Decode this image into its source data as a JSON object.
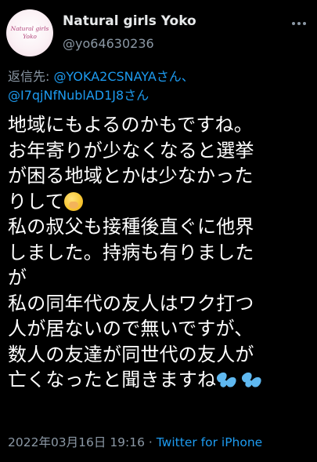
{
  "user": {
    "avatar_text": "Natural girls\nYoko",
    "display_name": "Natural girls Yoko",
    "handle": "@yo64630236"
  },
  "more_icon": "more-horizontal-icon",
  "reply": {
    "prefix": "返信先: ",
    "mention1": "@YOKA2CSNAYAさん、",
    "mention2": "@I7qjNfNublAD1J8さん"
  },
  "body_lines": [
    "地域にもよるのかもですね。",
    "お年寄りが少なくなると選挙",
    "が困る地域とかは少なかった",
    "りして",
    "私の叔父も接種後直ぐに他界",
    "しました。持病も有りました",
    "が",
    "私の同年代の友人はワク打つ",
    "人が居ないので無いですが、",
    "数人の友達が同世代の友人が",
    "亡くなったと聞きますね"
  ],
  "emojis": {
    "line4": "hand-over-mouth-emoji",
    "line11": "sweat-droplets-emoji"
  },
  "meta": {
    "date": "2022年03月16日 19:16",
    "separator": " · ",
    "source": "Twitter for iPhone"
  },
  "colors": {
    "background": "#000000",
    "text": "#ffffff",
    "secondary": "#8b98a5",
    "link": "#1d9bf0"
  }
}
